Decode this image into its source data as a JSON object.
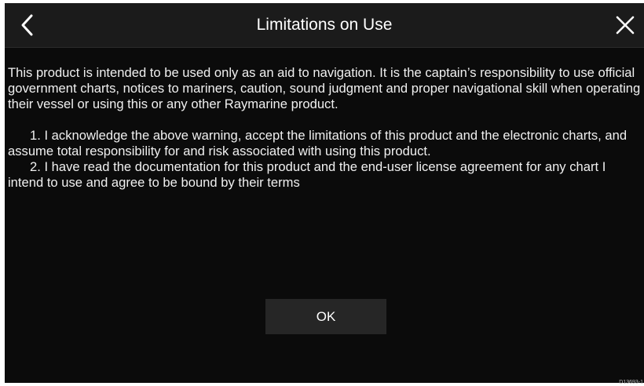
{
  "header": {
    "title": "Limitations on Use",
    "back_icon": "chevron-left-icon",
    "close_icon": "close-icon"
  },
  "body": {
    "intro": "This product is intended to be used only as an aid to navigation. It is the captain’s responsibility to use official government charts, notices to mariners, caution, sound judgment and proper navigational skill when operating their vessel or using this or any other Raymarine product.",
    "items": [
      "1. I acknowledge the above warning, accept the limitations of this product and the electronic charts, and assume total responsibility for and risk associated with using this product.",
      "2. I have read the documentation for this product and the end-user license agreement for any chart I intend to use and agree to be bound by their terms"
    ]
  },
  "actions": {
    "ok_label": "OK"
  },
  "reference_code": "D13693-1",
  "colors": {
    "background": "#0b0b0b",
    "header_background": "#1b1b1b",
    "button_background": "#262626",
    "text": "#f2f2f2"
  }
}
